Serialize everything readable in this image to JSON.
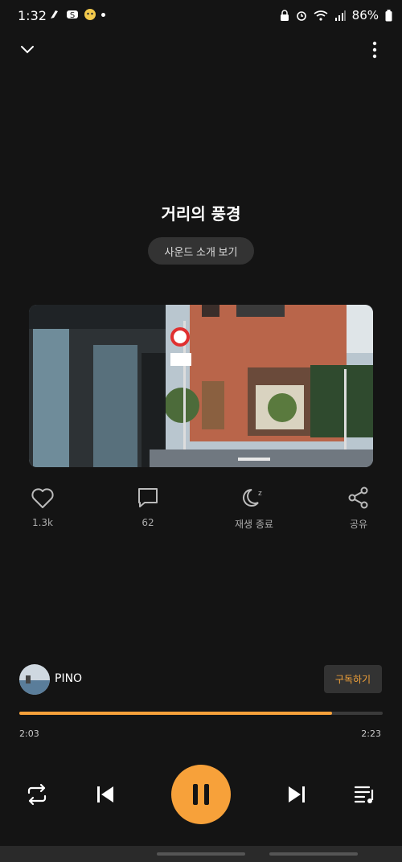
{
  "status_bar": {
    "time": "1:32",
    "battery": "86%"
  },
  "track": {
    "title": "거리의 풍경",
    "intro_button": "사운드 소개 보기"
  },
  "actions": {
    "like_count": "1.3k",
    "comment_count": "62",
    "sleep_label": "재생 종료",
    "share_label": "공유"
  },
  "channel": {
    "name": "PINO",
    "subscribe_label": "구독하기"
  },
  "playback": {
    "elapsed": "2:03",
    "total": "2:23",
    "progress_fraction": 0.86
  },
  "colors": {
    "background": "#141414",
    "accent": "#f7a13a",
    "chip": "#333333"
  }
}
